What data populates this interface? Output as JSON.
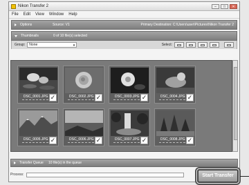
{
  "window": {
    "title": "Nikon Transfer 2"
  },
  "menu": [
    "File",
    "Edit",
    "View",
    "Window",
    "Help"
  ],
  "options_bar": {
    "label": "Options",
    "source": "Source: V1",
    "destination": "Primary Destination: C:\\Users\\user\\Pictures\\Nikon Transfer 2"
  },
  "thumbnails_bar": {
    "label": "Thumbnails",
    "count": "0 of 10 file(s) selected"
  },
  "toolbar": {
    "group_label": "Group:",
    "group_value": "None",
    "select_label": "Select:"
  },
  "thumbnails": [
    {
      "name": "DSC_0001.JPG",
      "checked": true
    },
    {
      "name": "DSC_0002.JPG",
      "checked": true
    },
    {
      "name": "DSC_0003.JPG",
      "checked": true
    },
    {
      "name": "DSC_0004.JPG",
      "checked": true
    },
    {
      "name": "DSC_0005.JPG",
      "checked": true
    },
    {
      "name": "DSC_0006.JPG",
      "checked": true
    },
    {
      "name": "DSC_0007.JPG",
      "checked": true
    },
    {
      "name": "DSC_0008.JPG",
      "checked": true
    }
  ],
  "queue": {
    "label": "Transfer Queue",
    "count": "10 file(s) in the queue"
  },
  "status": {
    "process_label": "Process:",
    "progress": 0
  },
  "start_button": {
    "label": "Start Transfer"
  },
  "colors": {
    "accent": "#6aa0d8",
    "panel": "#8e8e8e"
  }
}
